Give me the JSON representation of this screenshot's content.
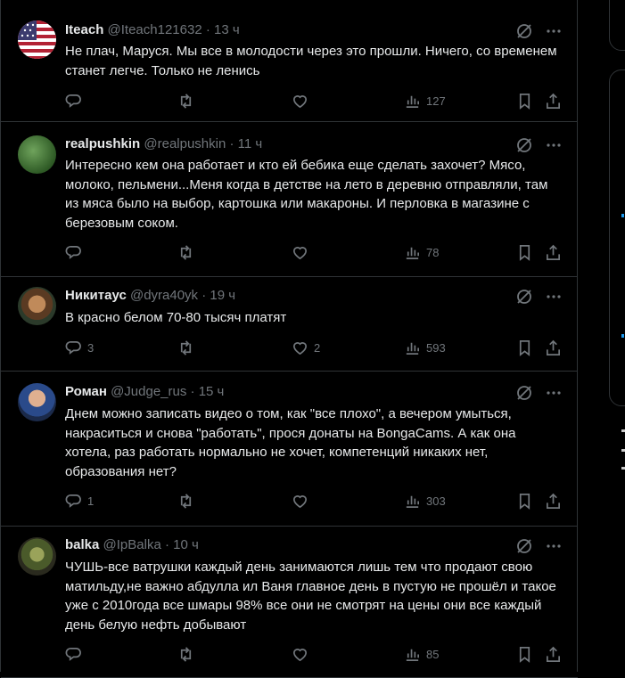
{
  "tweets": [
    {
      "name": "Iteach",
      "handle": "@Iteach121632",
      "time": "13 ч",
      "text": "Не плач, Маруся. Мы все в молодости через это прошли. Ничего, со временем станет легче. Только не ленись",
      "replies": "",
      "retweets": "",
      "likes": "",
      "views": "127"
    },
    {
      "name": "realpushkin",
      "handle": "@realpushkin",
      "time": "11 ч",
      "text": "Интересно кем она работает и кто ей бебика еще сделать захочет? Мясо, молоко, пельмени...Меня когда в детстве на лето в деревню отправляли, там из мяса было на выбор, картошка или макароны. И перловка в магазине с березовым соком.",
      "replies": "",
      "retweets": "",
      "likes": "",
      "views": "78"
    },
    {
      "name": "Никитаус",
      "handle": "@dyra40yk",
      "time": "19 ч",
      "text": "В красно белом 70-80 тысяч платят",
      "replies": "3",
      "retweets": "",
      "likes": "2",
      "views": "593"
    },
    {
      "name": "Роман",
      "handle": "@Judge_rus",
      "time": "15 ч",
      "text": "Днем можно записать видео о том, как \"все плохо\", а вечером умыться, накраситься и снова \"работать\", прося донаты на BongaCams. А как она хотела, раз работать нормально не хочет, компетенций никаких нет, образования нет?",
      "replies": "1",
      "retweets": "",
      "likes": "",
      "views": "303"
    },
    {
      "name": "balka",
      "handle": "@IpBalka",
      "time": "10 ч",
      "text": "ЧУШЬ-все ватрушки каждый день занимаются лишь тем что продают свою матильду,не важно абдулла ил Ваня главное день в пустую не прошёл и такое уже с 2010года все шмары 98% все они не смотрят на цены они все каждый день белую нефть добывают",
      "replies": "",
      "retweets": "",
      "likes": "",
      "views": "85"
    }
  ],
  "separator": " · ",
  "icons": {
    "grok": "grok-icon",
    "more": "more-icon",
    "reply": "reply-icon",
    "retweet": "retweet-icon",
    "like": "heart-icon",
    "views": "views-icon",
    "bookmark": "bookmark-icon",
    "share": "share-icon"
  },
  "colors": {
    "background": "#000000",
    "text": "#e7e9ea",
    "muted": "#71767b",
    "border": "#2f3336",
    "accent": "#1d9bf0"
  }
}
